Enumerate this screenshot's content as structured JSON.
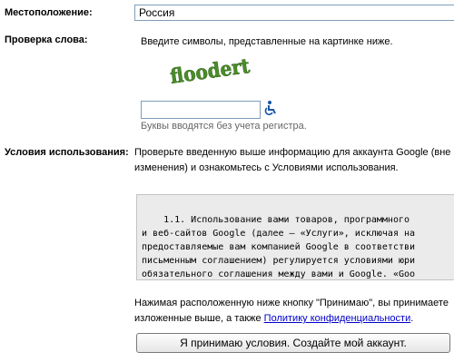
{
  "location": {
    "label": "Местоположение:",
    "value": "Россия"
  },
  "word_verification": {
    "label": "Проверка слова:",
    "instruction": "Введите символы, представленные на картинке ниже.",
    "captcha_text": "floodert",
    "input_value": "",
    "hint": "Буквы вводятся без учета регистра.",
    "accessibility_icon": "wheelchair-icon"
  },
  "terms": {
    "label": "Условия использования:",
    "intro_line1": "Проверьте введенную выше информацию для аккаунта Google (вне",
    "intro_line2": "изменения) и ознакомьтесь с Условиями использования.",
    "tos_lines": [
      "    1.1. Использование вами товаров, программного",
      "и веб-сайтов Google (далее – «Услуги», исключая на",
      "предоставляемые вам компанией Google в соответстви",
      "письменным соглашением) регулируется условиями юри",
      "обязательного соглашения между вами и Google. «Goo"
    ]
  },
  "accept": {
    "note_line1": "Нажимая расположенную ниже кнопку \"Принимаю\", вы принимаете",
    "note_line2_prefix": "изложенные выше, а также ",
    "privacy_link": "Политику конфиденциальности",
    "note_line2_suffix": ".",
    "button_label": "Я принимаю условия. Создайте мой аккаунт."
  },
  "colors": {
    "link": "#0000cc",
    "tos_background": "#ebebeb",
    "input_border": "#7f9db9",
    "accessibility_icon": "#1a56a6",
    "captcha_green": "#4c8c2b"
  }
}
